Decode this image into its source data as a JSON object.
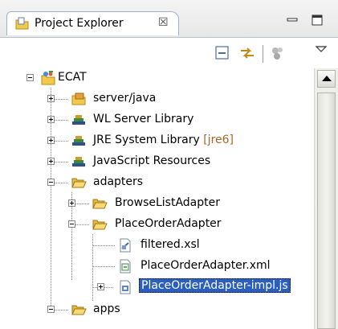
{
  "view": {
    "title": "Project Explorer",
    "close_glyph": "☒"
  },
  "tree": {
    "items": [
      {
        "label": "ECAT",
        "icon": "project-icon"
      },
      {
        "label": "server/java",
        "icon": "source-folder-icon"
      },
      {
        "label": "WL Server Library",
        "icon": "library-icon"
      },
      {
        "label": "JRE System Library",
        "decoration": "[jre6]",
        "icon": "library-icon"
      },
      {
        "label": "JavaScript Resources",
        "icon": "library-icon"
      },
      {
        "label": "adapters",
        "icon": "folder-open-icon"
      },
      {
        "label": "BrowseListAdapter",
        "icon": "folder-open-icon"
      },
      {
        "label": "PlaceOrderAdapter",
        "icon": "folder-open-icon"
      },
      {
        "label": "filtered.xsl",
        "icon": "xsl-file-icon"
      },
      {
        "label": "PlaceOrderAdapter.xml",
        "icon": "xml-file-icon"
      },
      {
        "label": "PlaceOrderAdapter-impl.js",
        "icon": "js-file-icon",
        "selected": true
      },
      {
        "label": "apps",
        "icon": "folder-open-icon"
      }
    ]
  },
  "colors": {
    "selection": "#2a5fc0",
    "decoration": "#a6672b",
    "folder": "#f2c94c"
  }
}
